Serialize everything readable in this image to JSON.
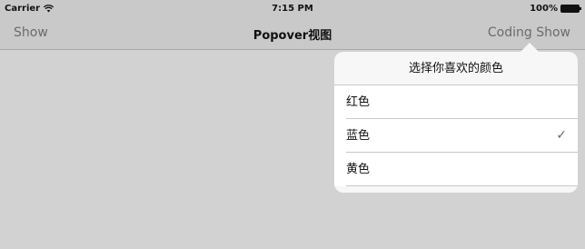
{
  "status_bar": {
    "carrier": "Carrier",
    "time": "7:15 PM",
    "battery": "100%"
  },
  "nav_bar": {
    "left_button": "Show",
    "title": "Popover视图",
    "right_button": "Coding Show"
  },
  "popover": {
    "title": "选择你喜欢的颜色",
    "items": [
      {
        "label": "红色",
        "selected": false
      },
      {
        "label": "蓝色",
        "selected": true
      },
      {
        "label": "黄色",
        "selected": false
      }
    ]
  },
  "icons": {
    "wifi": "wifi-icon",
    "battery": "battery-icon",
    "check": "checkmark-icon"
  }
}
